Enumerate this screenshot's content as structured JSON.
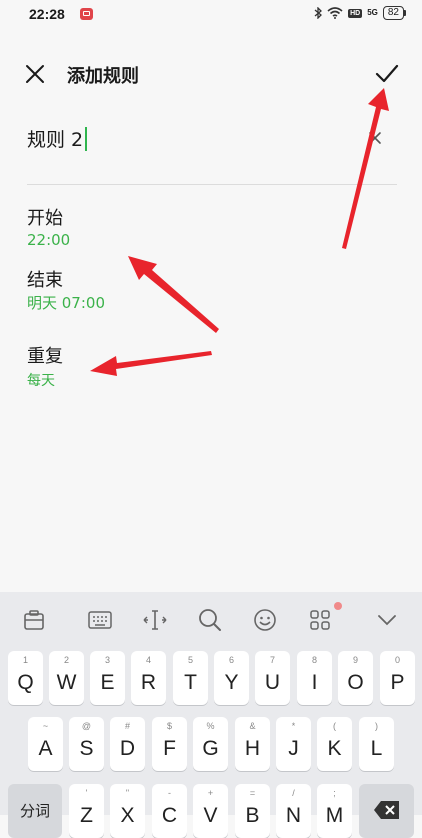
{
  "status_bar": {
    "time": "22:28",
    "hd_label": "HD",
    "network_label": "5G",
    "battery": "82"
  },
  "header": {
    "title": "添加规则"
  },
  "rule_name": {
    "value": "规则 2"
  },
  "settings": {
    "start": {
      "label": "开始",
      "value": "22:00"
    },
    "end": {
      "label": "结束",
      "value": "明天 07:00"
    },
    "repeat": {
      "label": "重复",
      "value": "每天"
    }
  },
  "colors": {
    "accent_green": "#3bb24a",
    "annotation_red": "#e8242c"
  },
  "icons": [
    "close-icon",
    "check-icon",
    "clear-icon",
    "clipboard-icon",
    "keyboard-icon",
    "cursor-move-icon",
    "search-icon",
    "emoji-icon",
    "apps-grid-icon",
    "collapse-icon",
    "backspace-icon"
  ],
  "keyboard": {
    "row1": [
      {
        "sub": "1",
        "main": "Q"
      },
      {
        "sub": "2",
        "main": "W"
      },
      {
        "sub": "3",
        "main": "E"
      },
      {
        "sub": "4",
        "main": "R"
      },
      {
        "sub": "5",
        "main": "T"
      },
      {
        "sub": "6",
        "main": "Y"
      },
      {
        "sub": "7",
        "main": "U"
      },
      {
        "sub": "8",
        "main": "I"
      },
      {
        "sub": "9",
        "main": "O"
      },
      {
        "sub": "0",
        "main": "P"
      }
    ],
    "row2": [
      {
        "sub": "~",
        "main": "A"
      },
      {
        "sub": "@",
        "main": "S"
      },
      {
        "sub": "#",
        "main": "D"
      },
      {
        "sub": "$",
        "main": "F"
      },
      {
        "sub": "%",
        "main": "G"
      },
      {
        "sub": "&",
        "main": "H"
      },
      {
        "sub": "*",
        "main": "J"
      },
      {
        "sub": "(",
        "main": "K"
      },
      {
        "sub": ")",
        "main": "L"
      }
    ],
    "row3": [
      {
        "sub": "'",
        "main": "Z"
      },
      {
        "sub": "\"",
        "main": "X"
      },
      {
        "sub": "-",
        "main": "C"
      },
      {
        "sub": "+",
        "main": "V"
      },
      {
        "sub": "=",
        "main": "B"
      },
      {
        "sub": "/",
        "main": "N"
      },
      {
        "sub": ";",
        "main": "M"
      }
    ],
    "segment_label": "分词"
  }
}
